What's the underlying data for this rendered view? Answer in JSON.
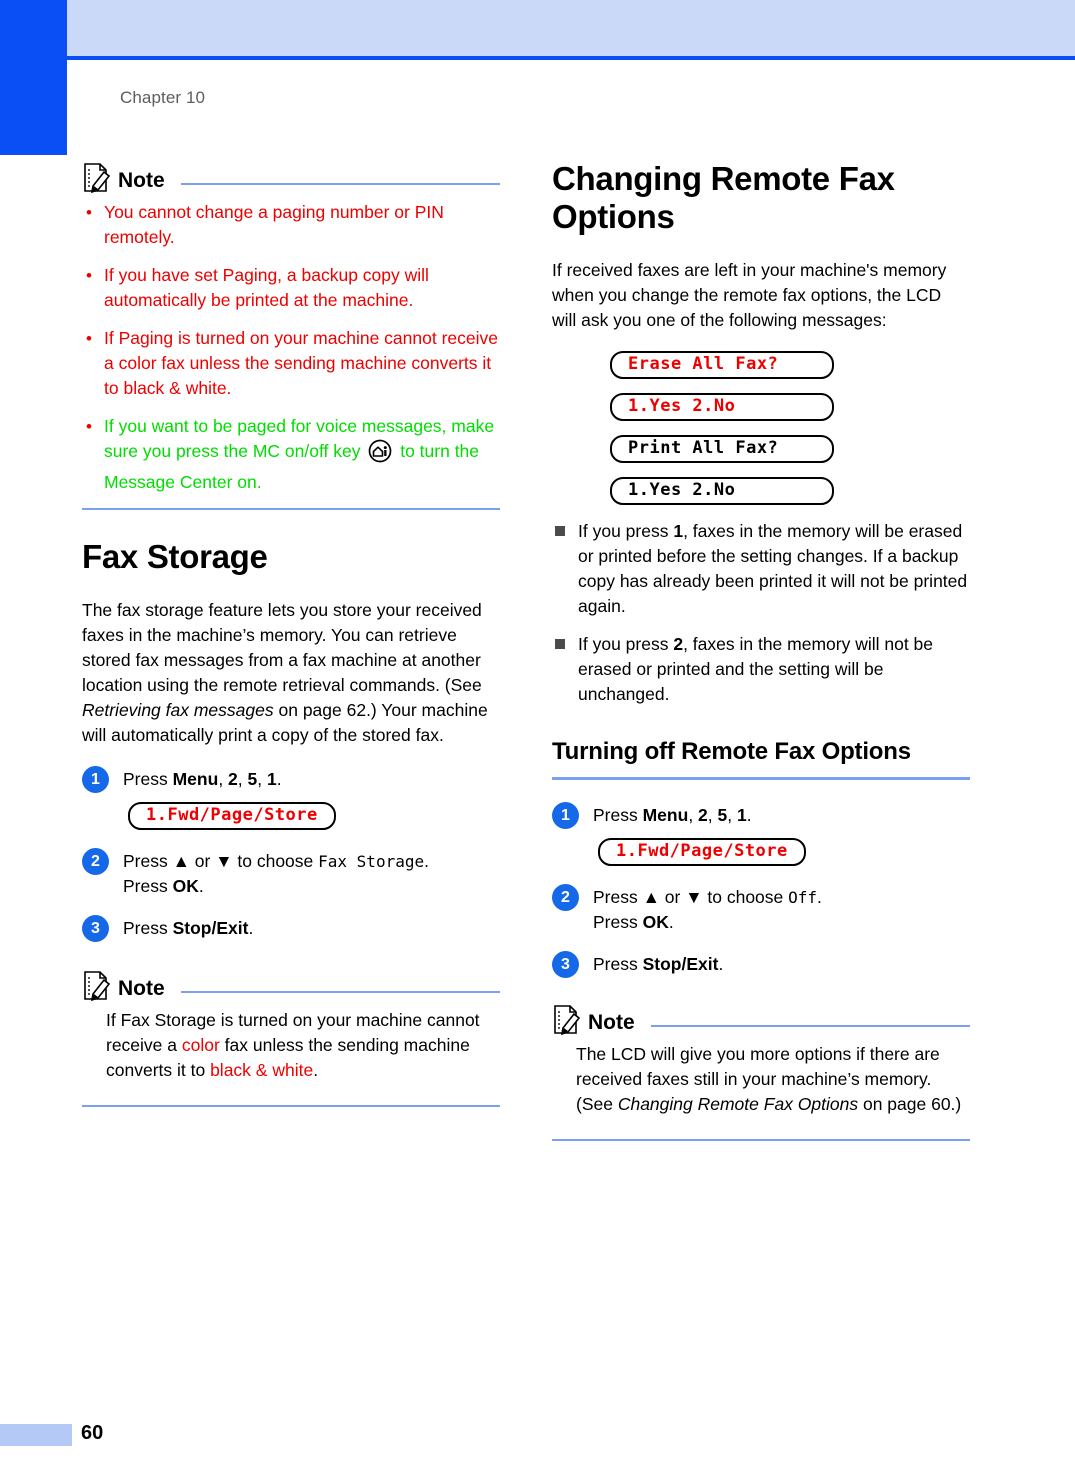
{
  "header": {
    "chapter": "Chapter 10"
  },
  "footer": {
    "page_number": "60"
  },
  "colors": {
    "accent_blue": "#0a4ef5",
    "rule_blue": "#7d9ff2",
    "red": "#ee0000",
    "green": "#00dd00",
    "step_circle": "#1569e8"
  },
  "left_column": {
    "note1": {
      "title": "Note",
      "bullets": [
        {
          "text": "You cannot change a paging number or PIN remotely.",
          "color": "red"
        },
        {
          "text": "If you have set Paging, a backup copy will automatically be printed at the machine.",
          "color": "red"
        },
        {
          "text": "If Paging is turned on your machine cannot receive a color fax unless the sending machine converts it to black & white.",
          "color": "red"
        },
        {
          "text_part1": "If you want to be paged for voice messages, make sure you press the MC on/off key",
          "icon": "mc-onoff-key-icon",
          "text_part2": "to turn the Message Center on.",
          "color": "green"
        }
      ]
    },
    "section_title": "Fax Storage",
    "intro_part1": "The fax storage feature lets you store your received faxes in the machine’s memory. You can retrieve stored fax messages from a fax machine at another location using the remote retrieval commands. (See ",
    "intro_italic": "Retrieving fax messages",
    "intro_part2": " on page 62.) Your machine will automatically print a copy of the stored fax.",
    "steps": [
      {
        "num": "1",
        "pre": "Press ",
        "b1": "Menu",
        "mid1": ", ",
        "b2": "2",
        "mid2": ", ",
        "b3": "5",
        "mid3": ", ",
        "b4": "1",
        "post": ".",
        "lcd": "1.Fwd/Page/Store",
        "lcd_color": "red"
      },
      {
        "num": "2",
        "line1_pre": "Press ▲ or ▼ to choose ",
        "line1_mono": "Fax Storage",
        "line1_post": ".",
        "line2_pre": "Press ",
        "line2_bold": "OK",
        "line2_post": "."
      },
      {
        "num": "3",
        "pre": "Press ",
        "bold": "Stop/Exit",
        "post": "."
      }
    ],
    "note2": {
      "title": "Note",
      "text_p1": "If Fax Storage is turned on your machine cannot receive a ",
      "text_red1": "color",
      "text_p2": " fax unless the sending machine converts it to ",
      "text_red2": "black & white",
      "text_p3": "."
    }
  },
  "right_column": {
    "section_title": "Changing Remote Fax Options",
    "intro": "If received faxes are left in your machine's memory when you change the remote fax options, the LCD will ask you one of the following messages:",
    "lcd_messages": [
      {
        "text": "Erase All Fax?",
        "color": "red"
      },
      {
        "text": "1.Yes 2.No",
        "color": "red"
      },
      {
        "text": "Print All Fax?",
        "color": "black"
      },
      {
        "text": "1.Yes 2.No",
        "color": "black"
      }
    ],
    "bullets": [
      {
        "pre": "If you press ",
        "bold": "1",
        "post": ", faxes in the memory will be erased or printed before the setting changes. If a backup copy has already been printed it will not be printed again."
      },
      {
        "pre": "If you press ",
        "bold": "2",
        "post": ", faxes in the memory will not be erased or printed and the setting will be unchanged."
      }
    ],
    "subsection_title": "Turning off Remote Fax Options",
    "steps": [
      {
        "num": "1",
        "pre": "Press ",
        "b1": "Menu",
        "mid1": ", ",
        "b2": "2",
        "mid2": ", ",
        "b3": "5",
        "mid3": ", ",
        "b4": "1",
        "post": ".",
        "lcd": "1.Fwd/Page/Store",
        "lcd_color": "red"
      },
      {
        "num": "2",
        "line1_pre": "Press ▲ or ▼ to choose ",
        "line1_mono": "Off",
        "line1_post": ".",
        "line2_pre": "Press ",
        "line2_bold": "OK",
        "line2_post": "."
      },
      {
        "num": "3",
        "pre": "Press ",
        "bold": "Stop/Exit",
        "post": "."
      }
    ],
    "note": {
      "title": "Note",
      "text_p1": "The LCD will give you more options if there are received faxes still in your machine’s memory. (See ",
      "text_italic": "Changing Remote Fax Options",
      "text_p2": " on page 60.)"
    }
  }
}
